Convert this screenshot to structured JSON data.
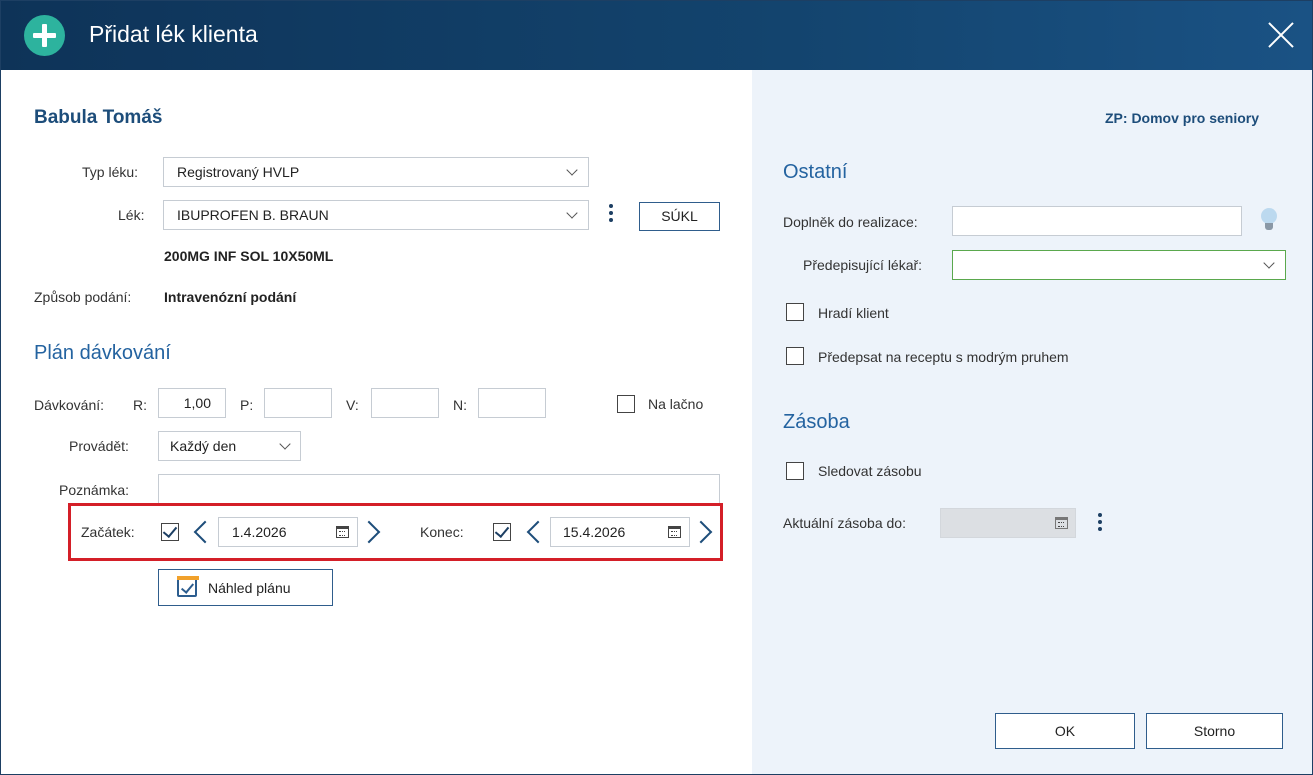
{
  "window": {
    "title": "Přidat lék klienta"
  },
  "client": {
    "name": "Babula Tomáš",
    "facility": "ZP: Domov pro seniory"
  },
  "drug": {
    "type_label": "Typ léku:",
    "type_value": "Registrovaný HVLP",
    "drug_label": "Lék:",
    "drug_value": "IBUPROFEN B. BRAUN",
    "sukl_button": "SÚKL",
    "strength": "200MG INF SOL 10X50ML",
    "route_label": "Způsob podání:",
    "route_value": "Intravenózní podání"
  },
  "plan": {
    "title": "Plán dávkování",
    "dosing_label": "Dávkování:",
    "r_label": "R:",
    "r_value": "1,00",
    "p_label": "P:",
    "p_value": "",
    "v_label": "V:",
    "v_value": "",
    "n_label": "N:",
    "n_value": "",
    "fasting_label": "Na lačno",
    "fasting_checked": false,
    "perform_label": "Provádět:",
    "perform_value": "Každý den",
    "note_label": "Poznámka:",
    "note_value": "",
    "start_label": "Začátek:",
    "start_checked": true,
    "start_date": "1.4.2026",
    "end_label": "Konec:",
    "end_checked": true,
    "end_date": "15.4.2026",
    "preview_button": "Náhled plánu"
  },
  "other": {
    "title": "Ostatní",
    "supplement_label": "Doplněk do realizace:",
    "supplement_value": "",
    "doctor_label": "Předepisující lékař:",
    "doctor_value": "",
    "paid_by_client_label": "Hradí klient",
    "paid_by_client_checked": false,
    "blue_stripe_label": "Předepsat na receptu s modrým pruhem",
    "blue_stripe_checked": false
  },
  "stock": {
    "title": "Zásoba",
    "track_label": "Sledovat zásobu",
    "track_checked": false,
    "current_label": "Aktuální zásoba do:",
    "current_value": ""
  },
  "buttons": {
    "ok": "OK",
    "cancel": "Storno"
  },
  "colors": {
    "header": "#13446e",
    "accent": "#2db39e",
    "highlight": "#d41f28",
    "panel": "#edf3fa"
  },
  "icons": [
    "plus-icon",
    "close-icon",
    "chevron-down-icon",
    "more-vertical-icon",
    "calendar-icon",
    "chevron-left-icon",
    "chevron-right-icon",
    "calendar-check-icon",
    "lightbulb-icon",
    "check-icon"
  ]
}
